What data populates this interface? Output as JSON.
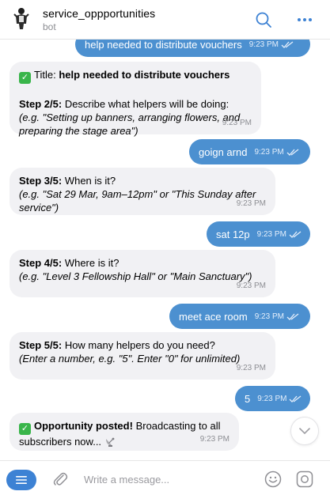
{
  "header": {
    "bot_name": "service_oppportunities",
    "subtitle": "bot"
  },
  "messages": {
    "m0": {
      "text": "help needed to distribute vouchers",
      "time": "9:23 PM"
    },
    "m1": {
      "title_label": "Title:",
      "title_value": "help needed to distribute vouchers",
      "step_label": "Step 2/5:",
      "step_text": "Describe what helpers will be doing:",
      "example": "(e.g. \"Setting up banners, arranging flowers, and preparing the stage area\")",
      "time": "9:23 PM"
    },
    "m2": {
      "text": "goign arnd",
      "time": "9:23 PM"
    },
    "m3": {
      "step_label": "Step 3/5:",
      "step_text": "When is it?",
      "example": "(e.g. \"Sat 29 Mar, 9am–12pm\" or \"This Sunday after service\")",
      "time": "9:23 PM"
    },
    "m4": {
      "text": "sat 12p",
      "time": "9:23 PM"
    },
    "m5": {
      "step_label": "Step 4/5:",
      "step_text": "Where is it?",
      "example": "(e.g. \"Level 3 Fellowship Hall\" or \"Main Sanctuary\")",
      "time": "9:23 PM"
    },
    "m6": {
      "text": "meet ace room",
      "time": "9:23 PM"
    },
    "m7": {
      "step_label": "Step 5/5:",
      "step_text": "How many helpers do you need?",
      "example": "(Enter a number, e.g. \"5\". Enter \"0\" for unlimited)",
      "time": "9:23 PM"
    },
    "m8": {
      "text": "5",
      "time": "9:23 PM"
    },
    "m9": {
      "bold": "Opportunity posted!",
      "text": "Broadcasting to all subscribers now...",
      "time": "9:23 PM"
    }
  },
  "composer": {
    "placeholder": "Write a message..."
  },
  "colors": {
    "outgoing_bubble": "#4c90d0",
    "incoming_bubble": "#f1f1f4",
    "accent": "#3d82d4",
    "check_green": "#39b54a"
  },
  "icons": {
    "search": "search-icon",
    "more": "more-icon",
    "menu": "menu-icon",
    "attach": "paperclip-icon",
    "emoji": "emoji-icon",
    "camera": "camera-icon",
    "scroll": "chevron-down-icon",
    "read": "double-check-icon",
    "check": "check-mark-icon",
    "dish": "satellite-dish-icon"
  }
}
